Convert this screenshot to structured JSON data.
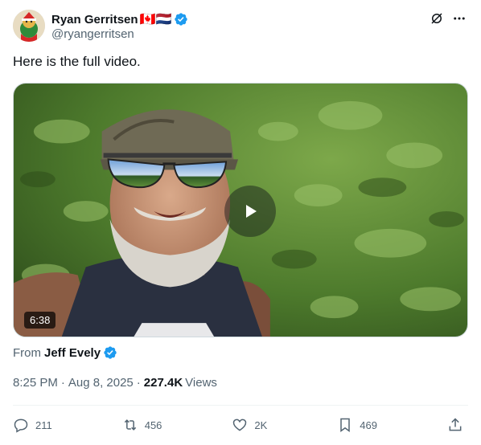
{
  "author": {
    "display_name": "Ryan Gerritsen",
    "flags": "🇨🇦🇳🇱",
    "handle": "@ryangerritsen"
  },
  "tweet": {
    "text": "Here is the full video."
  },
  "video": {
    "duration": "6:38"
  },
  "source": {
    "prefix": "From",
    "name": "Jeff Evely"
  },
  "meta": {
    "time": "8:25 PM",
    "dot1": "·",
    "date": "Aug 8, 2025",
    "dot2": "·",
    "views_count": "227.4K",
    "views_label": "Views"
  },
  "actions": {
    "replies": "211",
    "reposts": "456",
    "likes": "2K",
    "bookmarks": "469"
  },
  "colors": {
    "verified": "#1d9bf0",
    "text_secondary": "#536471"
  }
}
